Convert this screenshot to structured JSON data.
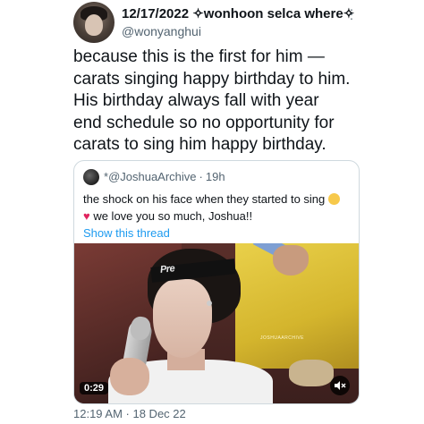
{
  "tweet": {
    "display_name": "12/17/2022 ✧wonhoon selca where✧",
    "handle": "@wonyanghui",
    "text": "because this is the first for him —\ncarats singing happy birthday to him.\nHis birthday always fall with year\nend schedule so no opportunity for\ncarats to sing him happy birthday.",
    "timestamp": "12:19 AM · 18 Dec 22"
  },
  "quote": {
    "prefix": "*",
    "handle": "@JoshuaArchive",
    "time": "19h",
    "line1": "the shock on his face when they started to sing",
    "line2": " we love you so much, Joshua!!",
    "show_thread": "Show this thread",
    "video": {
      "duration": "0:29",
      "headband_text": "Pre",
      "watermark": "JOSHUAARCHIVE"
    }
  },
  "icons": {
    "more": "more-options-icon",
    "mute": "mute-icon",
    "sweat": "sweat-smile-emoji-icon",
    "heart": "heart-emoji-icon"
  },
  "colors": {
    "link": "#1d9bf0",
    "secondary": "#536471",
    "border": "#cfd9de"
  }
}
